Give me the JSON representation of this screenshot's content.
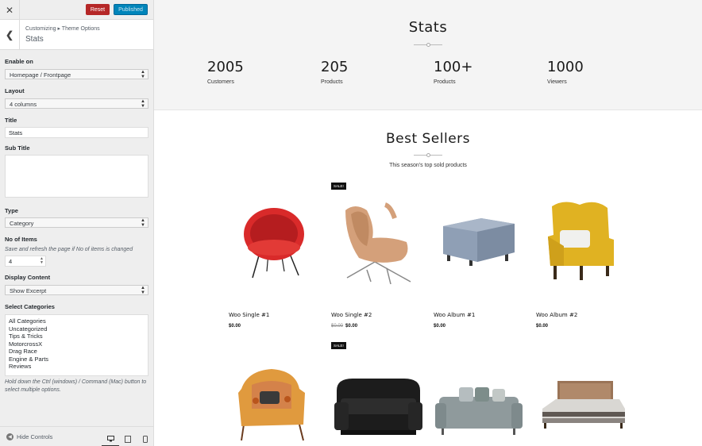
{
  "topbar": {
    "close_icon": "close-icon",
    "reset_label": "Reset",
    "publish_label": "Published",
    "publish_color": "#0085ba",
    "reset_color": "#b52727"
  },
  "panel": {
    "breadcrumb": "Customizing ▸ Theme Options",
    "title": "Stats"
  },
  "controls": {
    "enable_on": {
      "label": "Enable on",
      "value": "Homepage / Frontpage"
    },
    "layout": {
      "label": "Layout",
      "value": "4 columns"
    },
    "title": {
      "label": "Title",
      "value": "Stats"
    },
    "subtitle": {
      "label": "Sub Title",
      "value": ""
    },
    "type": {
      "label": "Type",
      "value": "Category"
    },
    "no_items": {
      "label": "No of Items",
      "note": "Save and refresh the page if No of items is changed",
      "value": "4"
    },
    "display": {
      "label": "Display Content",
      "value": "Show Excerpt"
    },
    "categories": {
      "label": "Select Categories",
      "options": [
        "All Categories",
        "Uncategorized",
        "Tips & Tricks",
        "MotorcrossX",
        "Drag Race",
        "Engine & Parts",
        "Reviews"
      ],
      "note": "Hold down the Ctrl (windows) / Command (Mac) button to select multiple options."
    }
  },
  "bottom": {
    "hide_label": "Hide Controls"
  },
  "preview": {
    "stats": {
      "title": "Stats",
      "items": [
        {
          "number": "2005",
          "label": "Customers"
        },
        {
          "number": "205",
          "label": "Products"
        },
        {
          "number": "100+",
          "label": "Products"
        },
        {
          "number": "1000",
          "label": "Viewers"
        }
      ]
    },
    "best_sellers": {
      "title": "Best Sellers",
      "subtitle": "This season's top sold products",
      "products": [
        {
          "name": "Woo Single #1",
          "price": "$0.00",
          "old_price": "",
          "sale": ""
        },
        {
          "name": "Woo Single #2",
          "price": "$0.00",
          "old_price": "$0.00",
          "sale": "SALE!"
        },
        {
          "name": "Woo Album #1",
          "price": "$0.00",
          "old_price": "",
          "sale": ""
        },
        {
          "name": "Woo Album #2",
          "price": "$0.00",
          "old_price": "",
          "sale": ""
        }
      ],
      "row2_sale": "SALE!"
    }
  }
}
